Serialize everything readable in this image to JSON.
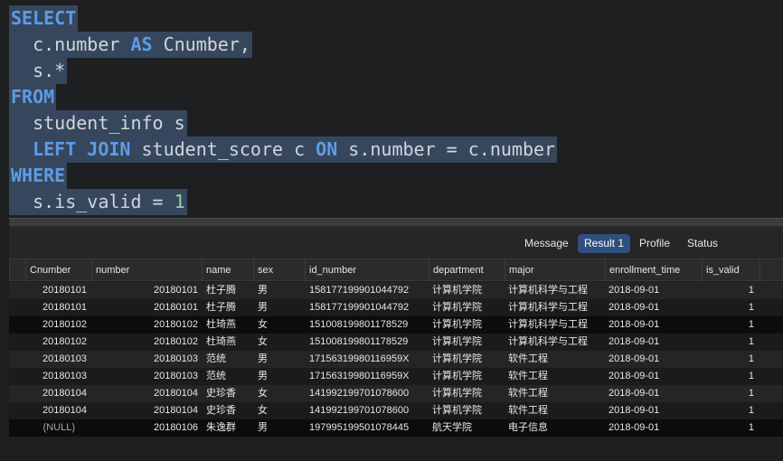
{
  "editor": {
    "lines": [
      [
        {
          "t": "SELECT",
          "k": "kw"
        }
      ],
      [
        {
          "t": "  c.number ",
          "k": "plain"
        },
        {
          "t": "AS",
          "k": "kw"
        },
        {
          "t": " Cnumber,",
          "k": "plain"
        }
      ],
      [
        {
          "t": "  s.*",
          "k": "plain"
        }
      ],
      [
        {
          "t": "FROM",
          "k": "kw"
        }
      ],
      [
        {
          "t": "  student_info s",
          "k": "plain"
        }
      ],
      [
        {
          "t": "  ",
          "k": "plain"
        },
        {
          "t": "LEFT JOIN",
          "k": "kw"
        },
        {
          "t": " student_score c ",
          "k": "plain"
        },
        {
          "t": "ON",
          "k": "kw"
        },
        {
          "t": " s.number = c.number",
          "k": "plain"
        }
      ],
      [
        {
          "t": "WHERE",
          "k": "kw"
        }
      ],
      [
        {
          "t": "  s.is_valid = ",
          "k": "plain"
        },
        {
          "t": "1",
          "k": "num"
        }
      ]
    ]
  },
  "tabs": [
    {
      "label": "Message",
      "active": false
    },
    {
      "label": "Result 1",
      "active": true
    },
    {
      "label": "Profile",
      "active": false
    },
    {
      "label": "Status",
      "active": false
    }
  ],
  "grid": {
    "columns": [
      "Cnumber",
      "number",
      "name",
      "sex",
      "id_number",
      "department",
      "major",
      "enrollment_time",
      "is_valid"
    ],
    "rows": [
      [
        "20180101",
        "20180101",
        "杜子腾",
        "男",
        "158177199901044792",
        "计算机学院",
        "计算机科学与工程",
        "2018-09-01",
        "1"
      ],
      [
        "20180101",
        "20180101",
        "杜子腾",
        "男",
        "158177199901044792",
        "计算机学院",
        "计算机科学与工程",
        "2018-09-01",
        "1"
      ],
      [
        "20180102",
        "20180102",
        "杜琦燕",
        "女",
        "151008199801178529",
        "计算机学院",
        "计算机科学与工程",
        "2018-09-01",
        "1"
      ],
      [
        "20180102",
        "20180102",
        "杜琦燕",
        "女",
        "151008199801178529",
        "计算机学院",
        "计算机科学与工程",
        "2018-09-01",
        "1"
      ],
      [
        "20180103",
        "20180103",
        "范统",
        "男",
        "17156319980116959X",
        "计算机学院",
        "软件工程",
        "2018-09-01",
        "1"
      ],
      [
        "20180103",
        "20180103",
        "范统",
        "男",
        "17156319980116959X",
        "计算机学院",
        "软件工程",
        "2018-09-01",
        "1"
      ],
      [
        "20180104",
        "20180104",
        "史珍香",
        "女",
        "141992199701078600",
        "计算机学院",
        "软件工程",
        "2018-09-01",
        "1"
      ],
      [
        "20180104",
        "20180104",
        "史珍香",
        "女",
        "141992199701078600",
        "计算机学院",
        "软件工程",
        "2018-09-01",
        "1"
      ],
      [
        "(NULL)",
        "20180106",
        "朱逸群",
        "男",
        "197995199501078445",
        "航天学院",
        "电子信息",
        "2018-09-01",
        "1"
      ]
    ]
  }
}
